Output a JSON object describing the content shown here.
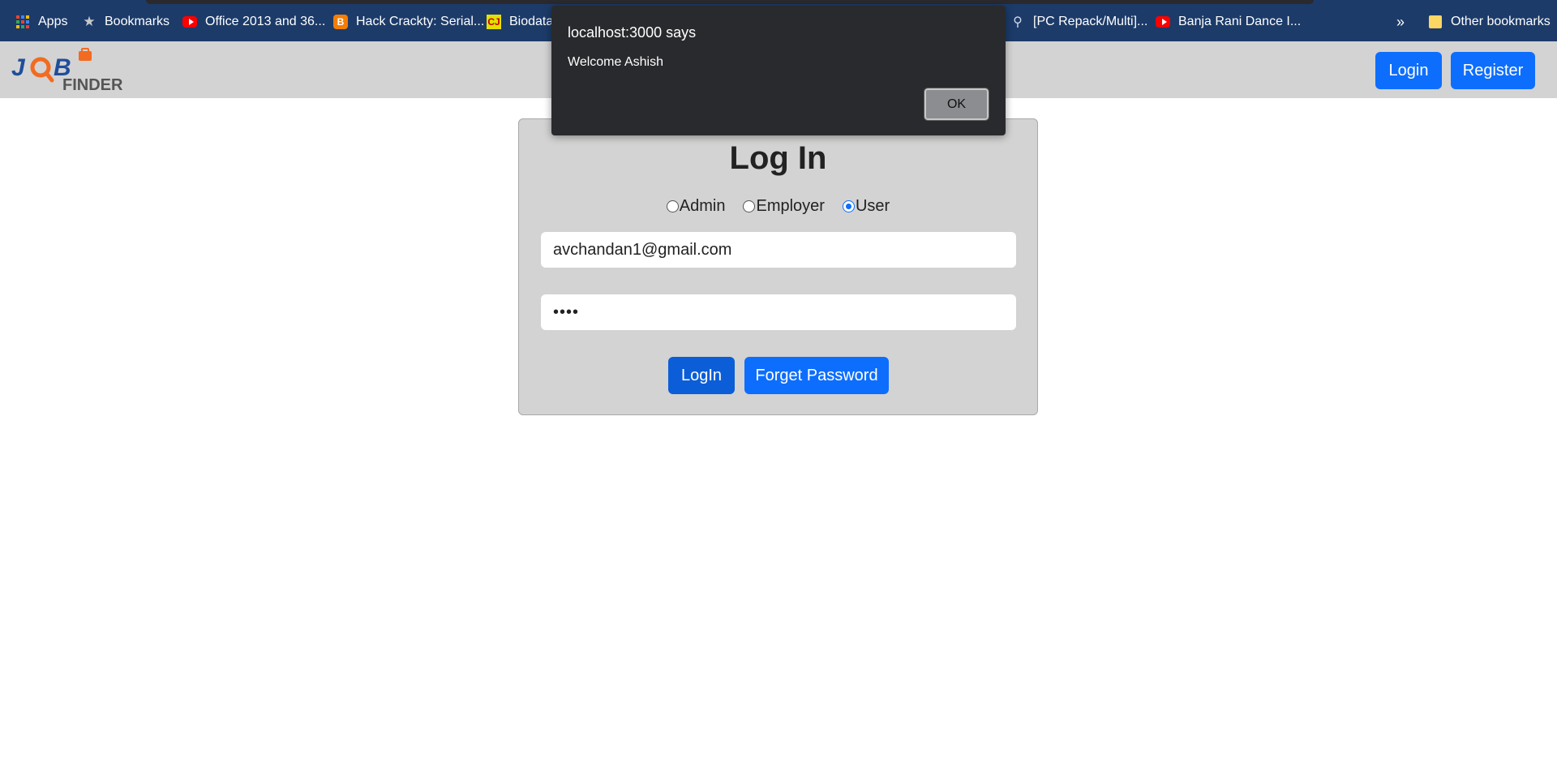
{
  "bookmarks": {
    "apps": "Apps",
    "bookmarks": "Bookmarks",
    "items": [
      "Office 2013 and 36...",
      "Hack Crackty: Serial...",
      "Biodata",
      "[PC Repack/Multi]...",
      "Banja Rani Dance I..."
    ],
    "overflow": "»",
    "other": "Other bookmarks"
  },
  "navbar": {
    "logo_text": "JOB FINDER",
    "login": "Login",
    "register": "Register"
  },
  "login_card": {
    "title": "Log In",
    "roles": [
      {
        "label": "Admin",
        "checked": false
      },
      {
        "label": "Employer",
        "checked": false
      },
      {
        "label": "User",
        "checked": true
      }
    ],
    "email": "avchandan1@gmail.com",
    "password_mask": "••••",
    "login_button": "LogIn",
    "forget_button": "Forget Password"
  },
  "dialog": {
    "title": "localhost:3000 says",
    "message": "Welcome Ashish",
    "ok": "OK"
  },
  "colors": {
    "primary": "#0d6efd",
    "bookmarks_bar": "#1c3b69",
    "navbar": "#d3d3d3"
  }
}
